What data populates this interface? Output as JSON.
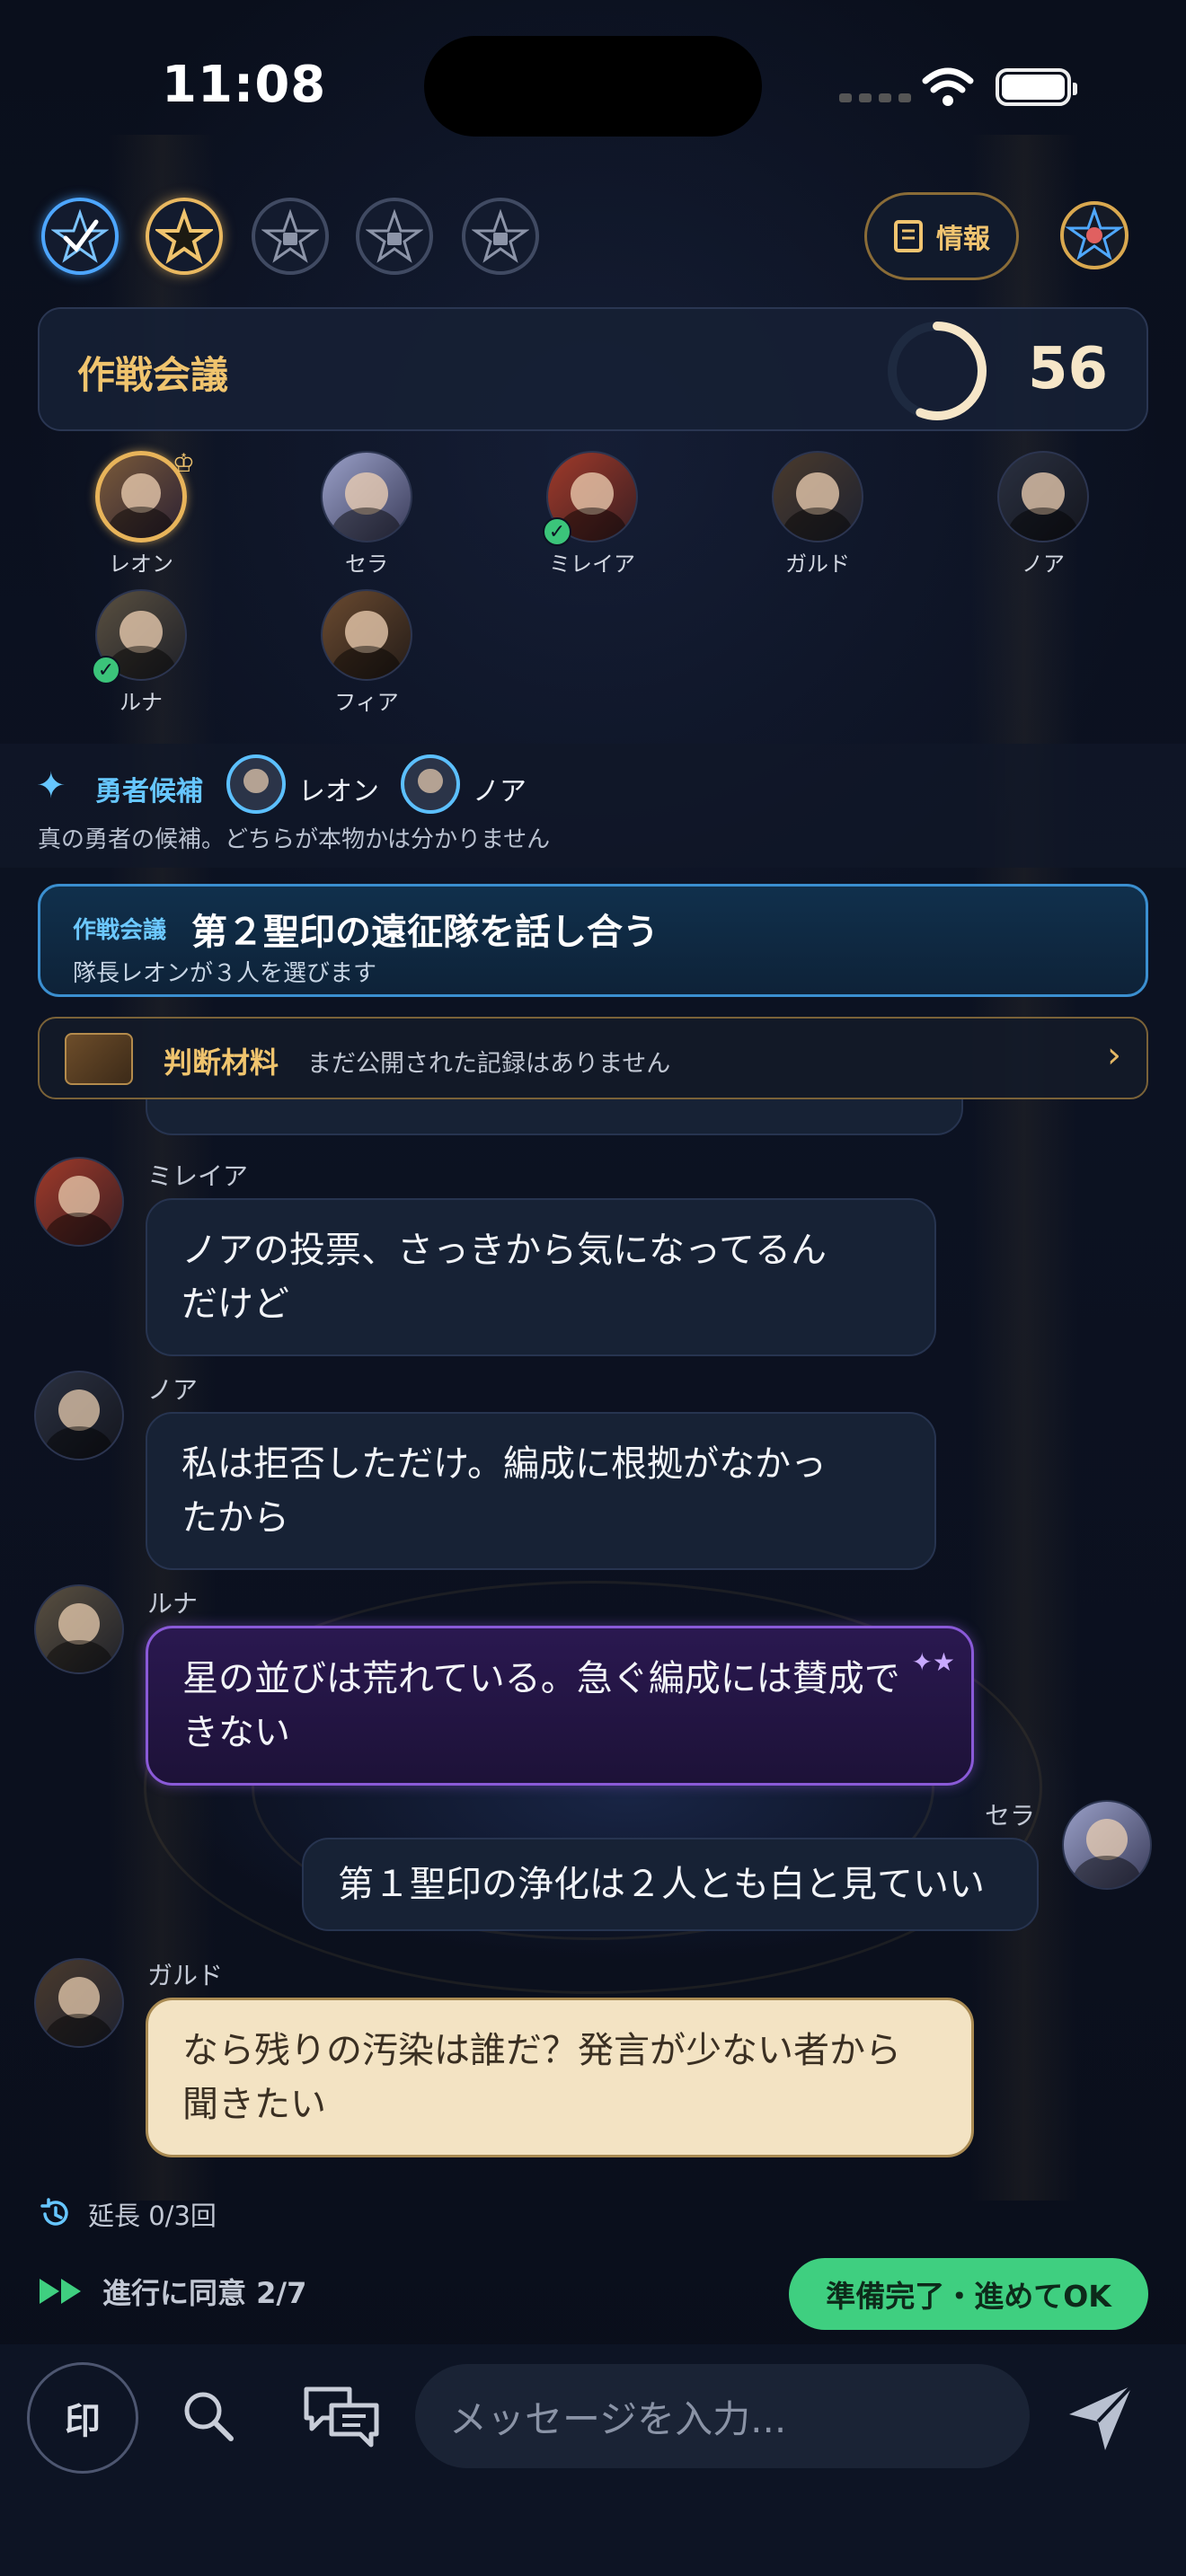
{
  "status_bar": {
    "time": "11:08"
  },
  "header": {
    "info_label": "情報",
    "badges": [
      "done",
      "current",
      "locked",
      "locked",
      "locked"
    ]
  },
  "phase": {
    "title": "作戦会議",
    "timer_value": "56",
    "timer_progress": 0.56
  },
  "players": [
    {
      "name": "レオン",
      "leader": true,
      "ready": false
    },
    {
      "name": "セラ",
      "leader": false,
      "ready": false
    },
    {
      "name": "ミレイア",
      "leader": false,
      "ready": true
    },
    {
      "name": "ガルド",
      "leader": false,
      "ready": false
    },
    {
      "name": "ノア",
      "leader": false,
      "ready": false
    },
    {
      "name": "ルナ",
      "leader": false,
      "ready": true
    },
    {
      "name": "フィア",
      "leader": false,
      "ready": false
    }
  ],
  "hero_candidates": {
    "label": "勇者候補",
    "names": [
      "レオン",
      "ノア"
    ],
    "description": "真の勇者の候補。どちらが本物かは分かりません"
  },
  "topic": {
    "tag": "作戦会議",
    "title": "第２聖印の遠征隊を話し合う",
    "subtitle": "隊長レオンが３人を選びます"
  },
  "evidence": {
    "label": "判断材料",
    "text": "まだ公開された記録はありません"
  },
  "messages": [
    {
      "sender": "ミレイア",
      "text_lines": [
        "ノアの投票、さっきから気になってるん",
        "だけど"
      ],
      "style": "normal",
      "side": "left"
    },
    {
      "sender": "ノア",
      "text_lines": [
        "私は拒否しただけ。編成に根拠がなかっ",
        "たから"
      ],
      "style": "normal",
      "side": "left"
    },
    {
      "sender": "ルナ",
      "text_lines": [
        "星の並びは荒れている。急ぐ編成には賛成で",
        "きない"
      ],
      "style": "purple",
      "side": "left"
    },
    {
      "sender": "セラ",
      "text_lines": [
        "第１聖印の浄化は２人とも白と見ていい"
      ],
      "style": "normal",
      "side": "right"
    },
    {
      "sender": "ガルド",
      "text_lines": [
        "なら残りの汚染は誰だ？発言が少ない者から",
        "聞きたい"
      ],
      "style": "cream",
      "side": "left"
    }
  ],
  "extension": {
    "label": "延長 0/3回"
  },
  "agree": {
    "label": "進行に同意 2/7"
  },
  "ready_button": {
    "label": "準備完了・進めてOK"
  },
  "composer": {
    "seal_label": "印",
    "placeholder": "メッセージを入力..."
  },
  "colors": {
    "accent_gold": "#f0c46e",
    "accent_blue": "#66c6ff",
    "ready_green": "#3fcf80",
    "purple": "#8a5ad8"
  }
}
